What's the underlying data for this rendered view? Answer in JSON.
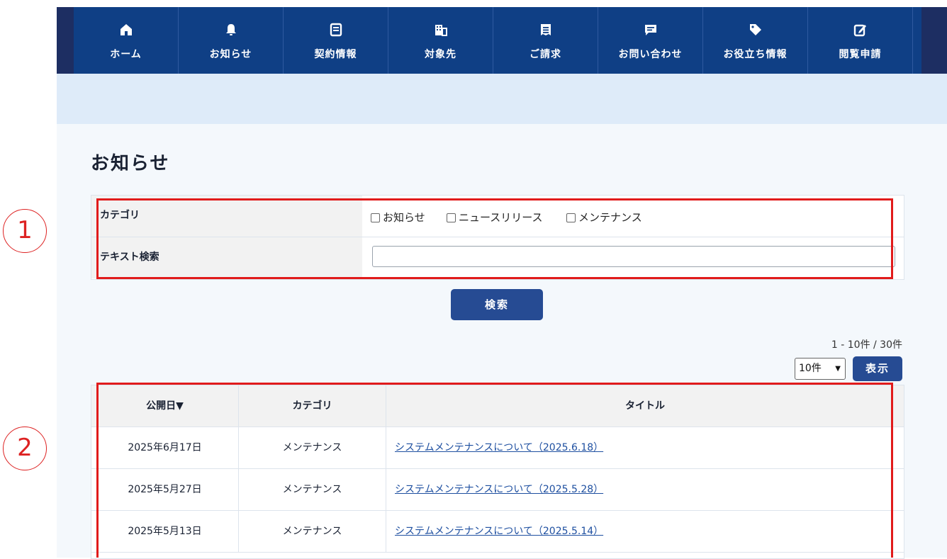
{
  "nav": {
    "items": [
      {
        "label": "ホーム",
        "icon": "home-icon"
      },
      {
        "label": "お知らせ",
        "icon": "bell-icon"
      },
      {
        "label": "契約情報",
        "icon": "document-icon"
      },
      {
        "label": "対象先",
        "icon": "building-icon"
      },
      {
        "label": "ご請求",
        "icon": "receipt-icon"
      },
      {
        "label": "お問い合わせ",
        "icon": "chat-icon"
      },
      {
        "label": "お役立ち情報",
        "icon": "tag-icon"
      },
      {
        "label": "閲覧申請",
        "icon": "edit-icon"
      }
    ]
  },
  "page": {
    "title": "お知らせ"
  },
  "filters": {
    "category_label": "カテゴリ",
    "categories": [
      "お知らせ",
      "ニュースリリース",
      "メンテナンス"
    ],
    "text_label": "テキスト検索",
    "text_value": ""
  },
  "search_button": "検索",
  "pagination": {
    "summary": "1 - 10件 / 30件",
    "per_page": "10件",
    "show_button": "表示"
  },
  "table": {
    "headers": [
      "公開日▼",
      "カテゴリ",
      "タイトル"
    ],
    "rows": [
      {
        "date": "2025年6月17日",
        "category": "メンテナンス",
        "title": "システムメンテナンスについて（2025.6.18）"
      },
      {
        "date": "2025年5月27日",
        "category": "メンテナンス",
        "title": "システムメンテナンスについて（2025.5.28）"
      },
      {
        "date": "2025年5月13日",
        "category": "メンテナンス",
        "title": "システムメンテナンスについて（2025.5.14）"
      }
    ]
  },
  "annotations": {
    "one": "1",
    "two": "2"
  },
  "colors": {
    "nav": "#0f3f85",
    "button": "#264b93",
    "highlight": "#e11b1b"
  }
}
